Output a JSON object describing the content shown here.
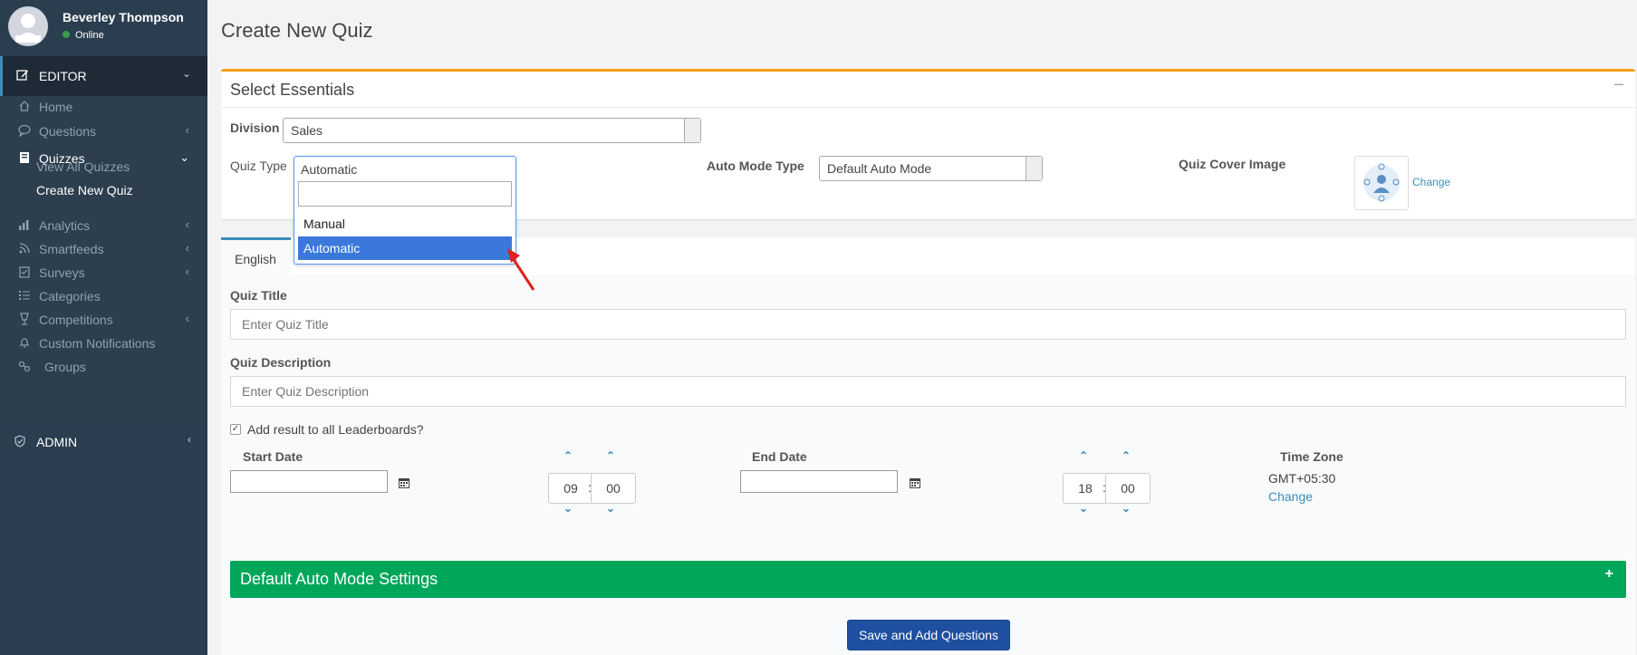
{
  "user": {
    "name": "Beverley Thompson",
    "status": "Online"
  },
  "sidebar": {
    "editor_label": "EDITOR",
    "items": [
      {
        "label": "Home",
        "icon": "home-icon"
      },
      {
        "label": "Questions",
        "icon": "chat-icon"
      },
      {
        "label": "Quizzes",
        "icon": "book-icon"
      },
      {
        "label": "Analytics",
        "icon": "bar-chart-icon"
      },
      {
        "label": "Smartfeeds",
        "icon": "feed-icon"
      },
      {
        "label": "Surveys",
        "icon": "clipboard-icon"
      },
      {
        "label": "Categories",
        "icon": "list-icon"
      },
      {
        "label": "Competitions",
        "icon": "trophy-icon"
      },
      {
        "label": "Custom Notifications",
        "icon": "bell-icon"
      },
      {
        "label": "Groups",
        "icon": "link-icon"
      }
    ],
    "sub_items": [
      "View All Quizzes",
      "Create New Quiz"
    ],
    "admin_label": "ADMIN"
  },
  "page": {
    "title": "Create New Quiz"
  },
  "essentials": {
    "title": "Select Essentials",
    "division_label": "Division",
    "division_value": "Sales",
    "quiz_type_label": "Quiz Type",
    "quiz_type_value": "Automatic",
    "auto_mode_label": "Auto Mode Type",
    "auto_mode_value": "Default Auto Mode",
    "cover_label": "Quiz Cover Image",
    "cover_change": "Change"
  },
  "dropdown": {
    "selected": "Automatic",
    "options": [
      "Manual",
      "Automatic"
    ]
  },
  "form": {
    "tab": "English",
    "title_label": "Quiz Title",
    "title_placeholder": "Enter Quiz Title",
    "desc_label": "Quiz Description",
    "desc_placeholder": "Enter Quiz Description",
    "leaderboard_label": "Add result to all Leaderboards?",
    "start_label": "Start Date",
    "start_hour": "09",
    "start_min": "00",
    "end_label": "End Date",
    "end_hour": "18",
    "end_min": "00",
    "tz_label": "Time Zone",
    "tz_value": "GMT+05:30",
    "tz_change": "Change",
    "auto_settings": "Default Auto Mode Settings",
    "save_button": "Save and Add Questions"
  }
}
